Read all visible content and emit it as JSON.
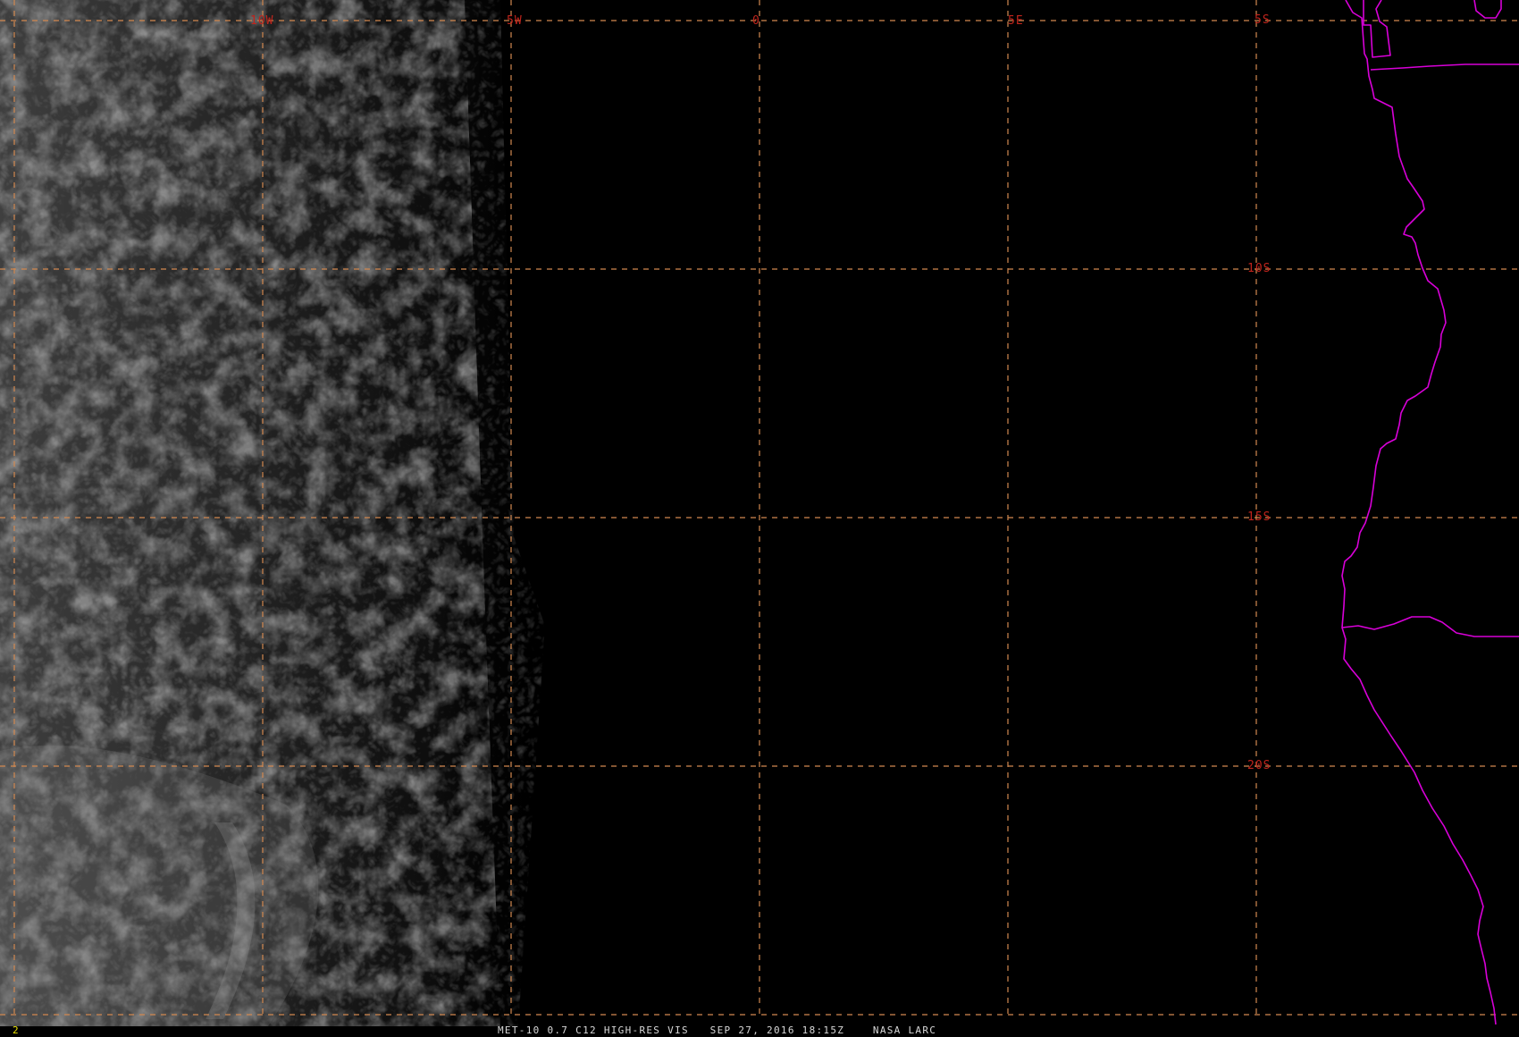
{
  "map": {
    "frame_number": "2",
    "caption": "MET-10 0.7 C12 HIGH-RES VIS   SEP 27, 2016 18:15Z    NASA LARC",
    "longitude_labels": [
      "10W",
      "5W",
      "0",
      "5E"
    ],
    "latitude_labels": [
      "5S",
      "10S",
      "15S",
      "20S"
    ],
    "colors": {
      "background": "#000000",
      "graticule": "#d2884f",
      "grid_label": "#c0241c",
      "coastline": "#d800d8",
      "caption_text": "#d8d8d8",
      "frame_number": "#e8e000",
      "cloud_tone": "#5a5a5a"
    }
  }
}
